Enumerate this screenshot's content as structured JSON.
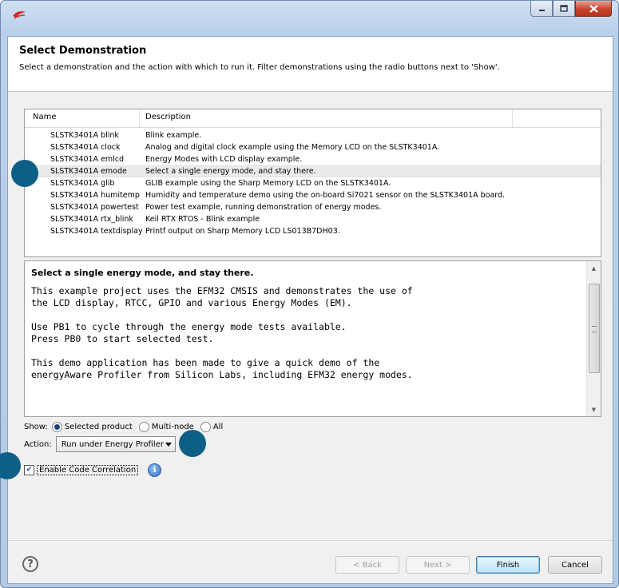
{
  "banner": {
    "title": "Select Demonstration",
    "description": "Select a demonstration and the action with which to run it. Filter demonstrations using the radio buttons next to 'Show'."
  },
  "table": {
    "headers": {
      "name": "Name",
      "description": "Description"
    },
    "rows": [
      {
        "name": "SLSTK3401A blink",
        "description": "Blink example."
      },
      {
        "name": "SLSTK3401A clock",
        "description": "Analog and digital clock example using the Memory LCD on the SLSTK3401A."
      },
      {
        "name": "SLSTK3401A emlcd",
        "description": "Energy Modes with LCD display example."
      },
      {
        "name": "SLSTK3401A emode",
        "description": "Select a single energy mode, and stay there."
      },
      {
        "name": "SLSTK3401A glib",
        "description": "GLIB example using the Sharp Memory LCD on the SLSTK3401A."
      },
      {
        "name": "SLSTK3401A humitemp",
        "description": "Humidity and temperature demo using the on-board Si7021 sensor on the SLSTK3401A board."
      },
      {
        "name": "SLSTK3401A powertest",
        "description": "Power test example, running demonstration of energy modes."
      },
      {
        "name": "SLSTK3401A rtx_blink",
        "description": "Keil RTX RTOS - Blink example"
      },
      {
        "name": "SLSTK3401A textdisplay",
        "description": "Printf output on Sharp Memory LCD LS013B7DH03."
      }
    ]
  },
  "details": {
    "title": "Select a single energy mode, and stay there.",
    "body": "This example project uses the EFM32 CMSIS and demonstrates the use of\nthe LCD display, RTCC, GPIO and various Energy Modes (EM).\n\nUse PB1 to cycle through the energy mode tests available.\nPress PB0 to start selected test.\n\nThis demo application has been made to give a quick demo of the\nenergyAware Profiler from Silicon Labs, including EFM32 energy modes."
  },
  "show": {
    "label": "Show:",
    "options": [
      "Selected product",
      "Multi-node",
      "All"
    ]
  },
  "action": {
    "label": "Action:",
    "value": "Run under Energy Profiler"
  },
  "code_correlation": {
    "label": "Enable Code Correlation",
    "checked": true
  },
  "buttons": {
    "back": "< Back",
    "next": "Next >",
    "finish": "Finish",
    "cancel": "Cancel"
  },
  "colors": {
    "marker": "#0e5f85",
    "titlebar": "#b9d0ea",
    "close_button": "#c7432c"
  }
}
